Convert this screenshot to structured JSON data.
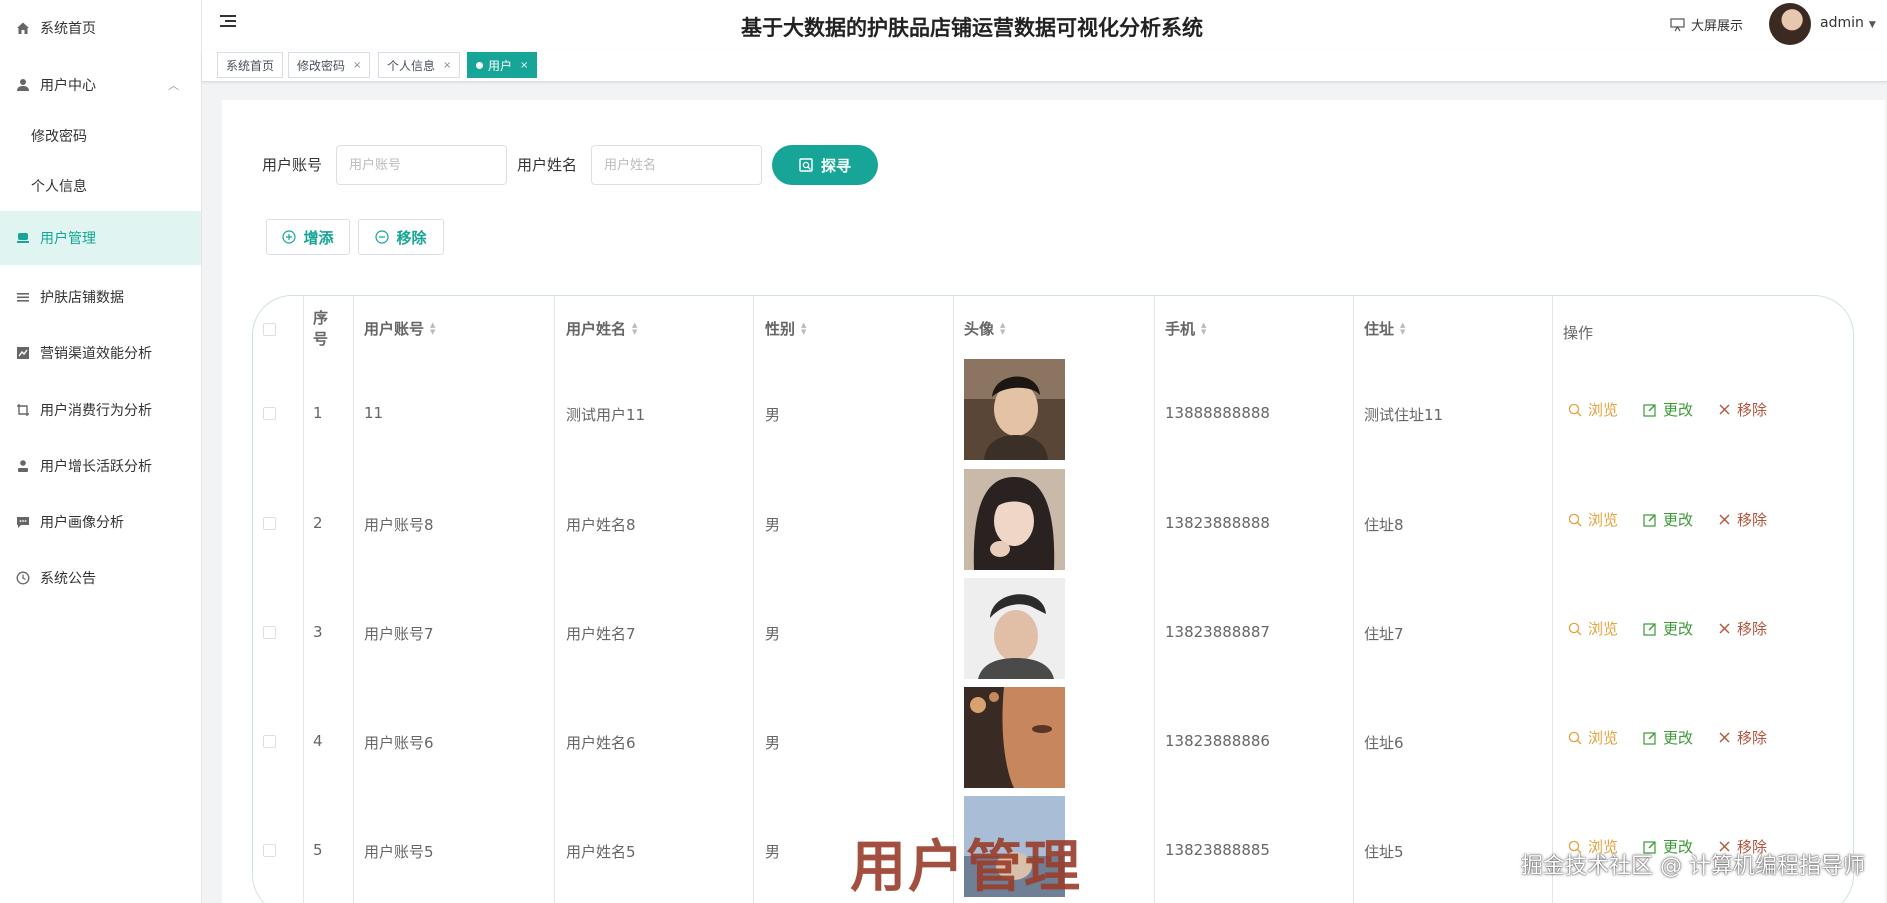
{
  "sidebar": {
    "items": [
      {
        "label": "系统首页",
        "icon": "home-icon"
      },
      {
        "label": "用户中心",
        "icon": "user-icon"
      },
      {
        "label": "修改密码"
      },
      {
        "label": "个人信息"
      },
      {
        "label": "用户管理",
        "icon": "user-manage-icon"
      },
      {
        "label": "护肤店铺数据",
        "icon": "list-icon"
      },
      {
        "label": "营销渠道效能分析",
        "icon": "chart-icon"
      },
      {
        "label": "用户消费行为分析",
        "icon": "crop-icon"
      },
      {
        "label": "用户增长活跃分析",
        "icon": "person-icon"
      },
      {
        "label": "用户画像分析",
        "icon": "message-icon"
      },
      {
        "label": "系统公告",
        "icon": "clock-icon"
      }
    ]
  },
  "header": {
    "title": "基于大数据的护肤品店铺运营数据可视化分析系统",
    "bigscreen": "大屏展示",
    "username": "admin"
  },
  "tabs": [
    {
      "label": "系统首页"
    },
    {
      "label": "修改密码"
    },
    {
      "label": "个人信息"
    },
    {
      "label": "用户"
    }
  ],
  "search": {
    "account_label": "用户账号",
    "account_placeholder": "用户账号",
    "name_label": "用户姓名",
    "name_placeholder": "用户姓名",
    "button": "探寻"
  },
  "actions": {
    "add": "增添",
    "remove": "移除"
  },
  "table": {
    "headers": {
      "index": "序号",
      "account": "用户账号",
      "name": "用户姓名",
      "gender": "性别",
      "avatar": "头像",
      "phone": "手机",
      "address": "住址",
      "ops": "操作"
    },
    "rows": [
      {
        "index": "1",
        "account": "11",
        "name": "测试用户11",
        "gender": "男",
        "phone": "13888888888",
        "address": "测试住址11"
      },
      {
        "index": "2",
        "account": "用户账号8",
        "name": "用户姓名8",
        "gender": "男",
        "phone": "13823888888",
        "address": "住址8"
      },
      {
        "index": "3",
        "account": "用户账号7",
        "name": "用户姓名7",
        "gender": "男",
        "phone": "13823888887",
        "address": "住址7"
      },
      {
        "index": "4",
        "account": "用户账号6",
        "name": "用户姓名6",
        "gender": "男",
        "phone": "13823888886",
        "address": "住址6"
      },
      {
        "index": "5",
        "account": "用户账号5",
        "name": "用户姓名5",
        "gender": "男",
        "phone": "13823888885",
        "address": "住址5"
      }
    ],
    "op_labels": {
      "view": "浏览",
      "edit": "更改",
      "delete": "移除"
    }
  },
  "overlay": {
    "title": "用户管理",
    "watermark": "掘金技术社区 @ 计算机编程指导师"
  },
  "colors": {
    "accent": "#16a596",
    "view": "#e6a23c",
    "edit": "#3a9b35",
    "delete": "#b5533c"
  }
}
